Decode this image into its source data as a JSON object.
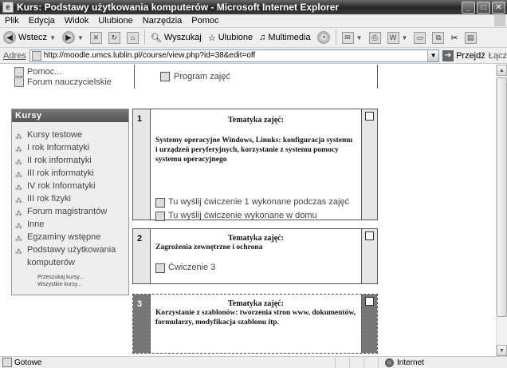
{
  "window": {
    "title": "Kurs: Podstawy użytkowania komputerów - Microsoft Internet Explorer"
  },
  "menu": [
    "Plik",
    "Edycja",
    "Widok",
    "Ulubione",
    "Narzędzia",
    "Pomoc"
  ],
  "toolbar": {
    "back_label": "Wstecz",
    "search_label": "Wyszukaj",
    "favorites_label": "Ulubione",
    "multimedia_label": "Multimedia"
  },
  "address": {
    "label": "Adres",
    "url": "http://moodle.umcs.lublin.pl/course/view.php?id=38&edit=off",
    "go_label": "Przejdź",
    "links_label": "Łącz"
  },
  "sidebar": {
    "top_items": [
      "Pomoc...",
      "Forum nauczycielskie"
    ],
    "courses_header": "Kursy",
    "courses": [
      "Kursy testowe",
      "I rok Informatyki",
      "II rok informatyki",
      "III rok informatyki",
      "IV rok Informatyki",
      "III rok fizyki",
      "Forum magistrantów",
      "Inne",
      "Egzaminy wstępne",
      "Podstawy użytkowania komputerów"
    ],
    "search_courses": "Przeszukaj kursy...",
    "all_courses": "Wszystkie kursy..."
  },
  "main": {
    "program_link": "Program zajęć",
    "topics": [
      {
        "number": "1",
        "heading": "Tematyka zajęć:",
        "description": "Systemy operacyjne Windows, Linuks: konfiguracja systemu i urządzeń peryferyjnych, korzystanie z systemu pomocy systemu operacyjnego",
        "resources": [
          "Tu wyślij ćwiczenie 1 wykonane podczas zajęć",
          "Tu wyślij ćwiczenie wykonane w domu"
        ]
      },
      {
        "number": "2",
        "heading": "Tematyka zajęć:",
        "description": "Zagrożenia zewnętrzne i ochrona",
        "resources": [
          "Ćwiczenie 3"
        ]
      },
      {
        "number": "3",
        "heading": "Tematyka zajęć:",
        "description": "Korzystanie z szablonów: tworzenia stron www, dokumentów, formularzy, modyfikacja szablonu itp.",
        "resources": []
      }
    ]
  },
  "status": {
    "text": "Gotowe",
    "zone": "Internet"
  }
}
